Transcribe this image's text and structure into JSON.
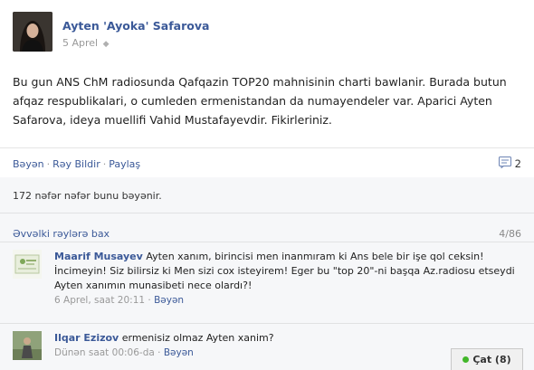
{
  "post": {
    "author": "Ayten 'Ayoka' Safarova",
    "date": "5 Aprel",
    "text": "Bu gun ANS ChM radiosunda Qafqazin TOP20 mahnisinin charti bawlanir. Burada butun afqaz respublikalari, o cumleden ermenistandan da numayendeler var. Aparici Ayten Safarova, ideya muellifi Vahid Mustafayevdir. Fikirleriniz."
  },
  "actions": {
    "like": "Bəyən",
    "comment": "Rəy Bildir",
    "share": "Paylaş",
    "sep": "·",
    "share_count": "2"
  },
  "ufi": {
    "likes_text": "172 nəfər nəfər bunu bəyənir.",
    "previous_comments": "Əvvəlki rəylərə bax",
    "comment_count": "4/86"
  },
  "comments": [
    {
      "name": "Maarif Musayev",
      "text": " Ayten xanım, birincisi men inanmıram ki Ans bele bir işe qol ceksin! İncimeyin! Siz bilirsiz ki Men sizi cox isteyirem! Eger bu \"top 20\"-ni başqa Az.radiosu etseydi Ayten xanımın munasibeti nece olardı?!",
      "time": "6 Aprel, saat 20:11",
      "like": "Bəyən"
    },
    {
      "name": "Ilqar Ezizov",
      "text": " ermenisiz olmaz Ayten xanim?",
      "time": "Dünən saat 00:06-da",
      "like": "Bəyən"
    }
  ],
  "chat": {
    "label": "Çat (8)"
  },
  "colors": {
    "link": "#3b5998",
    "ufi_bg": "#f6f7f9",
    "online": "#42b72a"
  }
}
